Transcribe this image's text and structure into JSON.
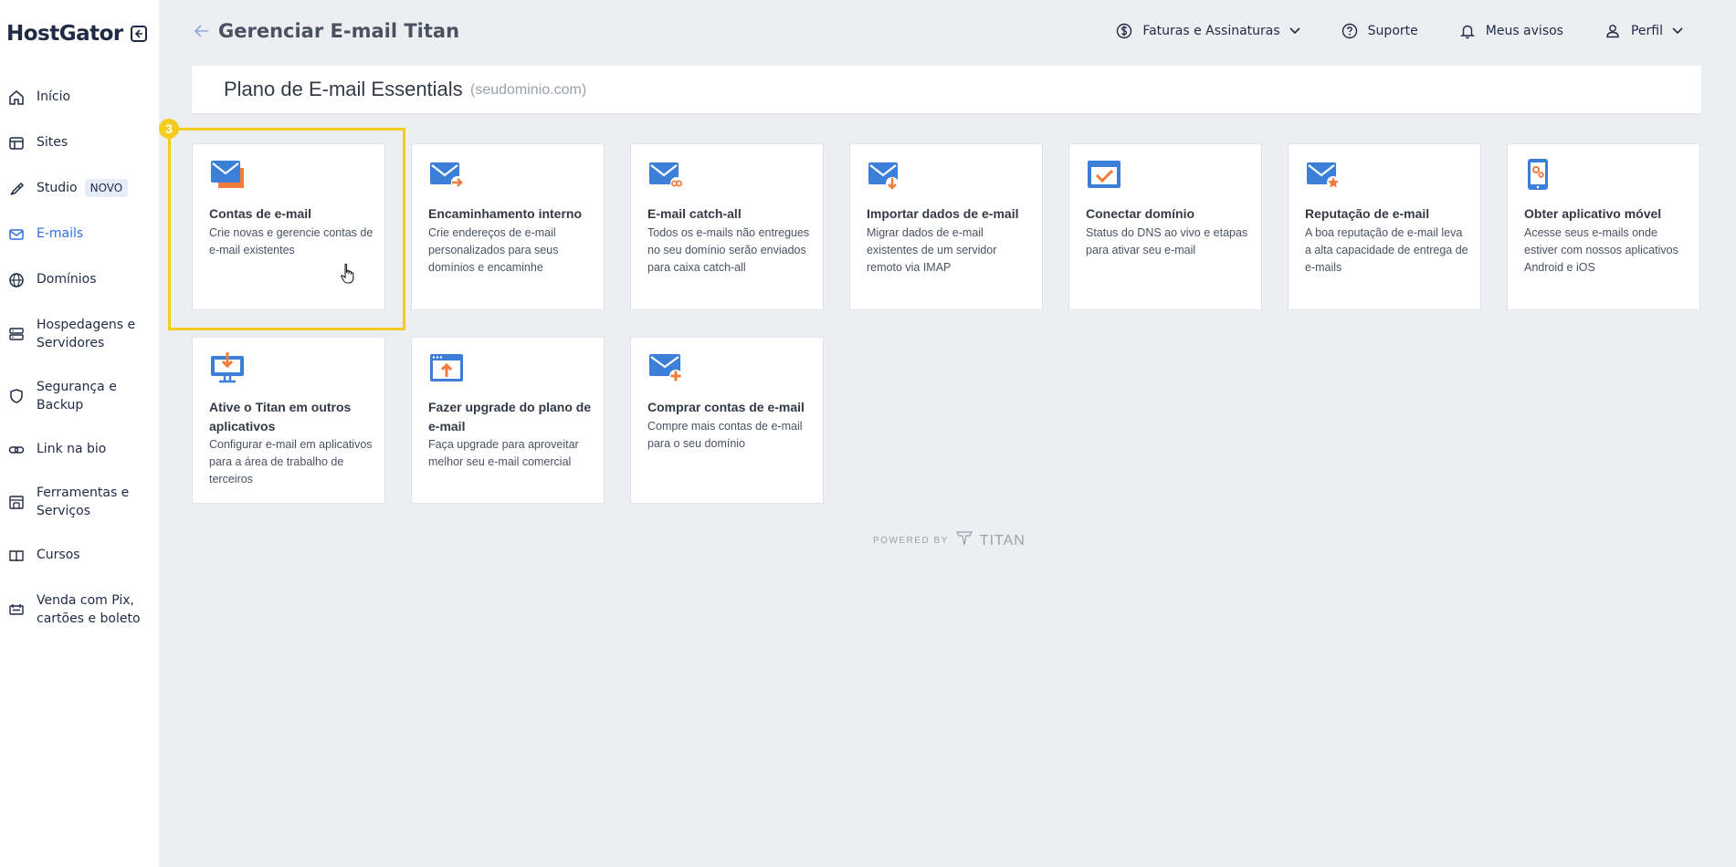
{
  "brand": {
    "name": "HostGator"
  },
  "sidebar": {
    "items": [
      {
        "label": "Início",
        "icon": "home-icon"
      },
      {
        "label": "Sites",
        "icon": "window-icon"
      },
      {
        "label": "Studio",
        "icon": "brush-icon",
        "badge": "NOVO"
      },
      {
        "label": "E-mails",
        "icon": "mail-icon",
        "active": true
      },
      {
        "label": "Domínios",
        "icon": "globe-icon"
      },
      {
        "label": "Hospedagens e Servidores",
        "icon": "server-icon"
      },
      {
        "label": "Segurança e Backup",
        "icon": "shield-icon"
      },
      {
        "label": "Link na bio",
        "icon": "link-icon"
      },
      {
        "label": "Ferramentas e Serviços",
        "icon": "tools-icon"
      },
      {
        "label": "Cursos",
        "icon": "book-icon"
      },
      {
        "label": "Venda com Pix, cartões e boleto",
        "icon": "payment-icon"
      }
    ]
  },
  "header": {
    "title": "Gerenciar E-mail Titan",
    "nav": [
      {
        "label": "Faturas e Assinaturas",
        "icon": "dollar-icon",
        "dropdown": true
      },
      {
        "label": "Suporte",
        "icon": "help-icon"
      },
      {
        "label": "Meus avisos",
        "icon": "bell-icon"
      },
      {
        "label": "Perfil",
        "icon": "user-icon",
        "dropdown": true
      }
    ]
  },
  "plan": {
    "title": "Plano de E-mail Essentials",
    "domain": "(seudominio.com)"
  },
  "step_badge": "3",
  "cards": [
    {
      "title": "Contas de e-mail",
      "desc": "Crie novas e gerencie contas de e-mail existentes",
      "icon": "mail-accounts-icon"
    },
    {
      "title": "Encaminhamento interno",
      "desc": "Crie endereços de e-mail personalizados para seus domínios e encaminhe",
      "icon": "mail-forward-icon"
    },
    {
      "title": "E-mail catch-all",
      "desc": "Todos os e-mails não entregues no seu domínio serão enviados para caixa catch-all",
      "icon": "mail-catchall-icon"
    },
    {
      "title": "Importar dados de e-mail",
      "desc": "Migrar dados de e-mail existentes de um servidor remoto via IMAP",
      "icon": "mail-import-icon"
    },
    {
      "title": "Conectar domínio",
      "desc": "Status do DNS ao vivo e etapas para ativar seu e-mail",
      "icon": "domain-check-icon"
    },
    {
      "title": "Reputação de e-mail",
      "desc": "A boa reputação de e-mail leva a alta capacidade de entrega de e-mails",
      "icon": "mail-reputation-icon"
    },
    {
      "title": "Obter aplicativo móvel",
      "desc": "Acesse seus e-mails onde estiver com nossos aplicativos Android e iOS",
      "icon": "mobile-app-icon"
    },
    {
      "title": "Ative o Titan em outros aplicativos",
      "desc": "Configurar e-mail em aplicativos para a área de trabalho de terceiros",
      "icon": "desktop-download-icon"
    },
    {
      "title": "Fazer upgrade do plano de e-mail",
      "desc": "Faça upgrade para aproveitar melhor seu e-mail comercial",
      "icon": "upgrade-icon"
    },
    {
      "title": "Comprar contas de e-mail",
      "desc": "Compre mais contas de e-mail para o seu domínio",
      "icon": "mail-add-icon"
    }
  ],
  "footer": {
    "powered_by": "POWERED BY",
    "brand": "TITAN"
  },
  "colors": {
    "accent": "#2f6ee5",
    "icon_blue": "#3b7fd9",
    "icon_orange": "#f07c3c",
    "highlight": "#f4cc1f"
  }
}
